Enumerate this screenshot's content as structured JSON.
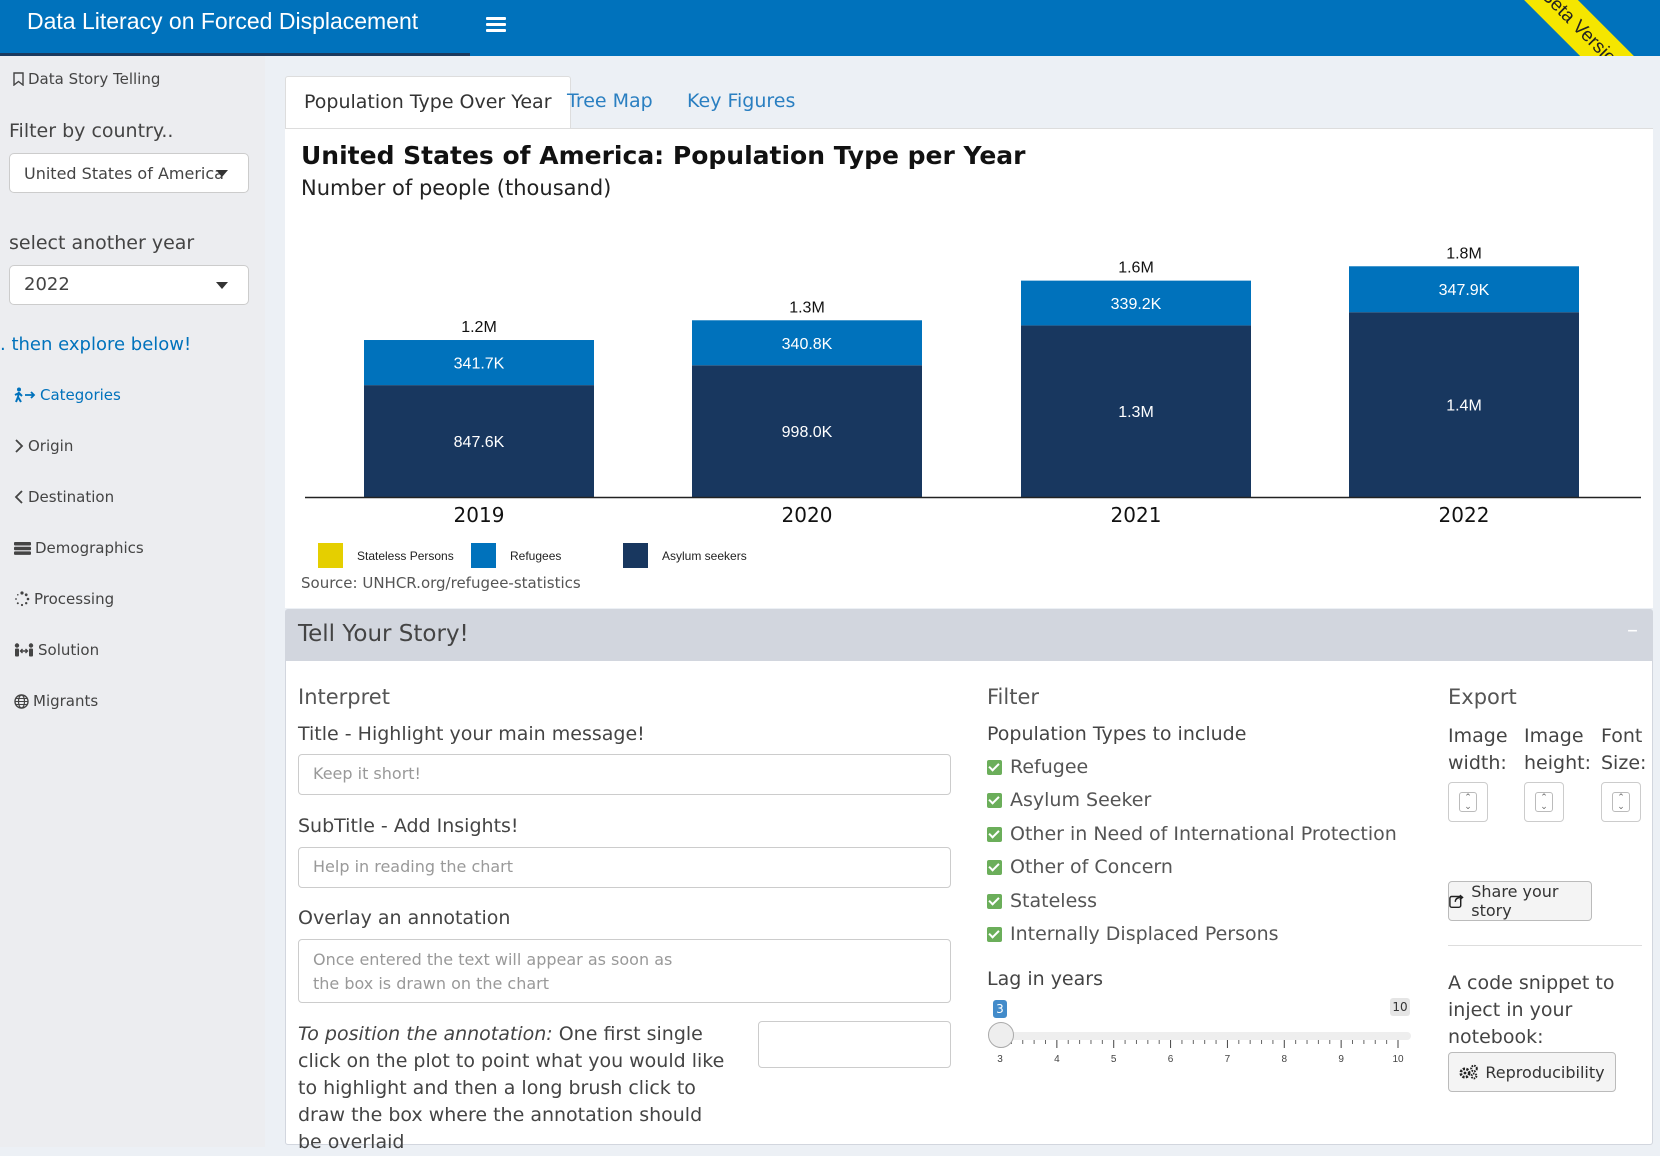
{
  "header": {
    "title": "Data Literacy on Forced Displacement",
    "ribbon": "Beta Version ❗"
  },
  "sidebar": {
    "story_link": "Data Story Telling",
    "filter_country_label": "Filter by country..",
    "country_value": "United States of America",
    "year_label": "select another year",
    "year_value": "2022",
    "explore_text": ". then explore below!",
    "nav": [
      {
        "label": "Categories"
      },
      {
        "label": "Origin"
      },
      {
        "label": "Destination"
      },
      {
        "label": "Demographics"
      },
      {
        "label": "Processing"
      },
      {
        "label": "Solution"
      },
      {
        "label": "Migrants"
      }
    ]
  },
  "tabs": [
    "Population Type Over Year",
    "Tree Map",
    "Key Figures"
  ],
  "chart_data": {
    "type": "bar",
    "stacked": true,
    "title": "United States of America: Population Type per Year",
    "subtitle": "Number of people (thousand)",
    "categories": [
      "2019",
      "2020",
      "2021",
      "2022"
    ],
    "series": [
      {
        "name": "Asylum seekers",
        "color": "#18375f",
        "values": [
          847.6,
          998.0,
          1300,
          1400
        ],
        "labels": [
          "847.6K",
          "998.0K",
          "1.3M",
          "1.4M"
        ]
      },
      {
        "name": "Refugees",
        "color": "#0072bc",
        "values": [
          341.7,
          340.8,
          339.2,
          347.9
        ],
        "labels": [
          "341.7K",
          "340.8K",
          "339.2K",
          "347.9K"
        ]
      }
    ],
    "totals": [
      "1.2M",
      "1.3M",
      "1.6M",
      "1.8M"
    ],
    "legend": [
      {
        "name": "Stateless Persons",
        "color": "#e5cf00"
      },
      {
        "name": "Refugees",
        "color": "#0072bc"
      },
      {
        "name": "Asylum seekers",
        "color": "#18375f"
      }
    ],
    "source": "Source: UNHCR.org/refugee-statistics"
  },
  "story": {
    "title": "Tell Your Story!",
    "collapse": "–",
    "interpret": {
      "heading": "Interpret",
      "title_label": "Title - Highlight your main message!",
      "title_placeholder": "Keep it short!",
      "subtitle_label": "SubTitle - Add Insights!",
      "subtitle_placeholder": "Help in reading the chart",
      "annotation_label": "Overlay an annotation",
      "annotation_placeholder": "Once entered the text will appear as soon as the box is drawn on the chart",
      "position_note_italic": "To position the annotation:",
      "position_note": " One first single click on the plot to point what you would like to highlight and then a long brush click to draw the box where the annotation should be overlaid"
    },
    "filter": {
      "heading": "Filter",
      "pop_types_label": "Population Types to include",
      "options": [
        "Refugee",
        "Asylum Seeker",
        "Other in Need of International Protection",
        "Other of Concern",
        "Stateless",
        "Internally Displaced Persons"
      ],
      "lag_label": "Lag in years",
      "lag_min": "3",
      "lag_max": "10",
      "lag_value": "3",
      "ticks": [
        "3",
        "4",
        "5",
        "6",
        "7",
        "8",
        "9",
        "10"
      ]
    },
    "export": {
      "heading": "Export",
      "width_label": "Image width:",
      "height_label": "Image height:",
      "font_label": "Font Size:",
      "share_button": "Share your story",
      "snippet_text": "A code snippet to inject in your notebook:",
      "repro_button": "Reproducibility"
    }
  }
}
